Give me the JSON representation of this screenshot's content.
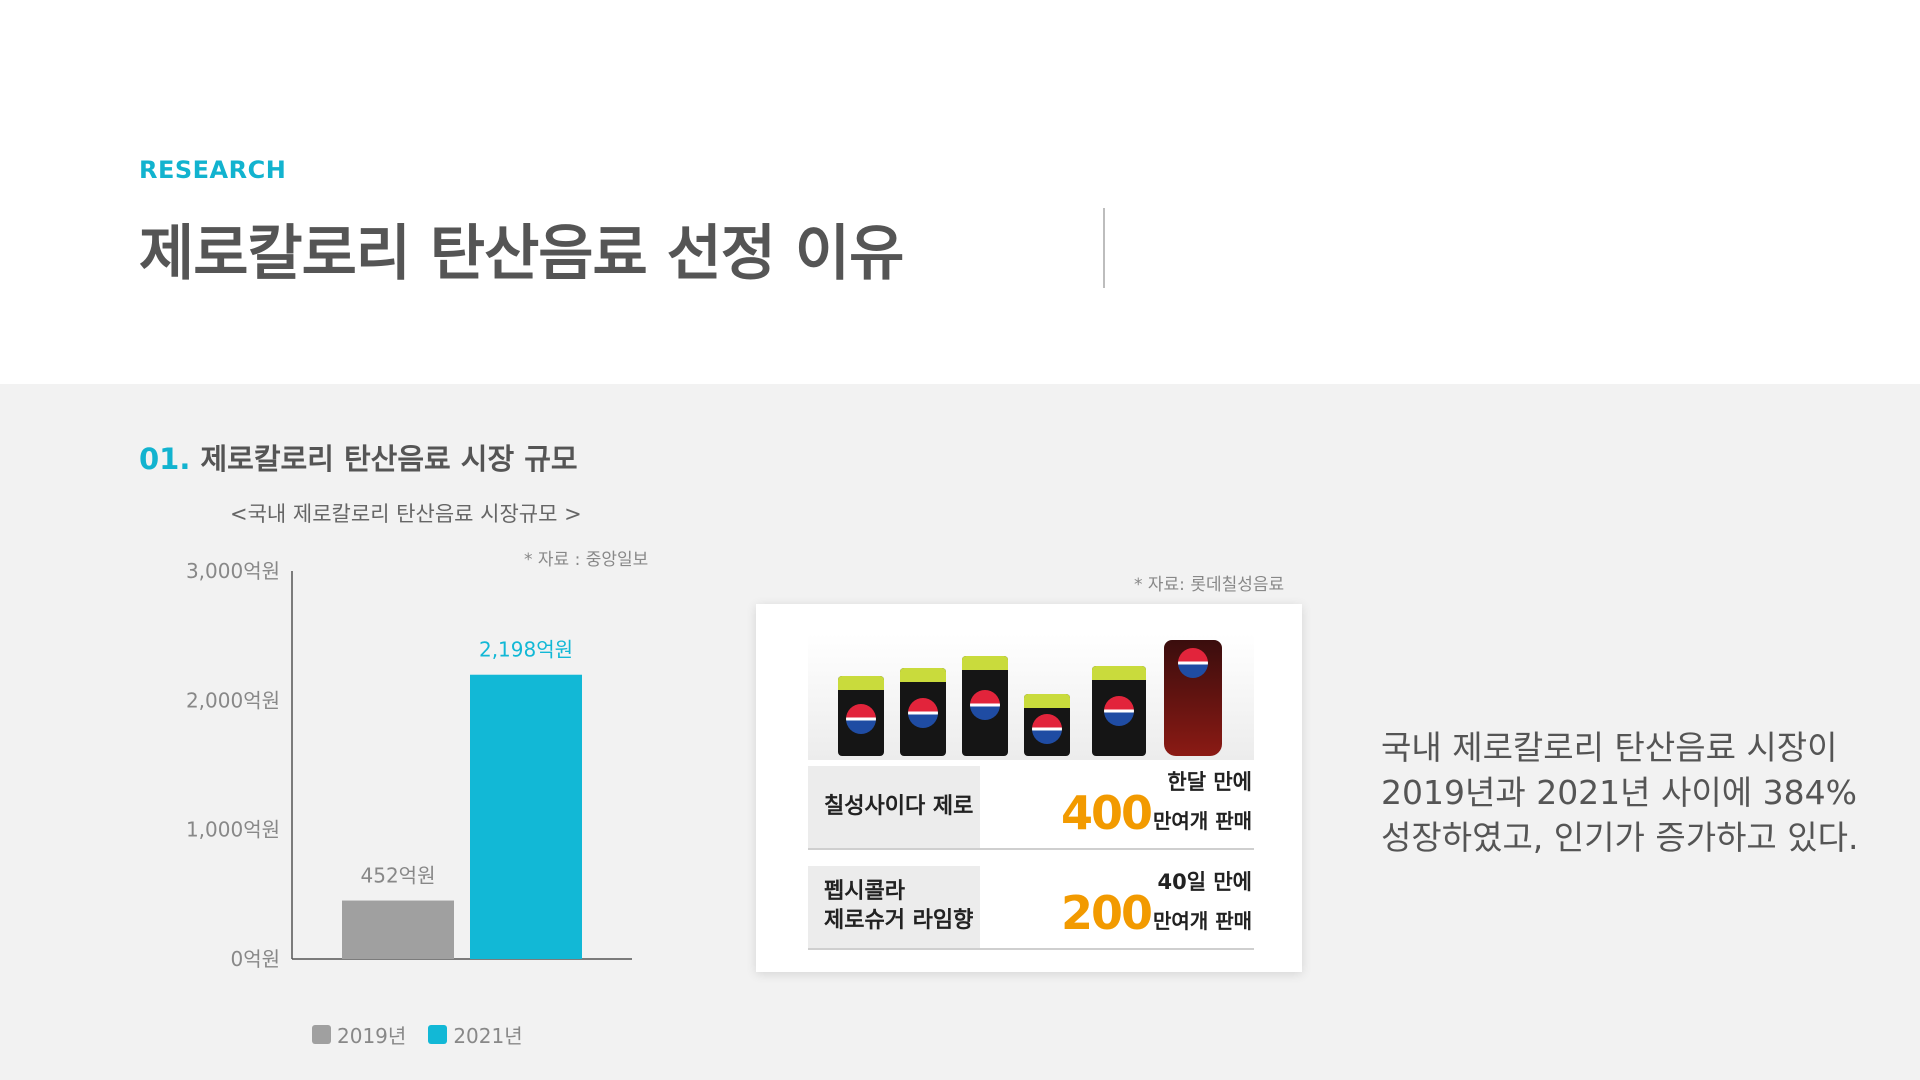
{
  "header": {
    "eyebrow": "RESEARCH",
    "title": "제로칼로리 탄산음료 선정 이유"
  },
  "section": {
    "number": "01.",
    "title": "제로칼로리 탄산음료 시장 규모"
  },
  "chart_data": {
    "type": "bar",
    "title": "<국내 제로칼로리 탄산음료 시장규모 >",
    "source": "* 자료 : 중앙일보",
    "categories": [
      "2019년",
      "2021년"
    ],
    "values": [
      452,
      2198
    ],
    "value_labels": [
      "452억원",
      "2,198억원"
    ],
    "colors": [
      "#a0a0a0",
      "#12b8d6"
    ],
    "ylim": [
      0,
      3000
    ],
    "yticks": [
      0,
      1000,
      2000,
      3000
    ],
    "ytick_labels": [
      "0억원",
      "1,000억원",
      "2,000억원",
      "3,000억원"
    ],
    "xlabel": "",
    "ylabel": "",
    "grid": false,
    "legend": {
      "position": "bottom",
      "entries": [
        "2019년",
        "2021년"
      ]
    }
  },
  "image_card": {
    "source": "* 자료: 롯데칠성음료",
    "rows": [
      {
        "name_lines": [
          "칠성사이다 제로"
        ],
        "period": "한달 만에",
        "count": "400",
        "unit": "만여개 판매"
      },
      {
        "name_lines": [
          "펩시콜라",
          "제로슈거 라임향"
        ],
        "period": "40일 만에",
        "count": "200",
        "unit": "만여개 판매"
      }
    ]
  },
  "description": {
    "lines": [
      "국내 제로칼로리 탄산음료 시장이",
      "2019년과 2021년 사이에 384%",
      "성장하였고, 인기가 증가하고 있다."
    ]
  }
}
